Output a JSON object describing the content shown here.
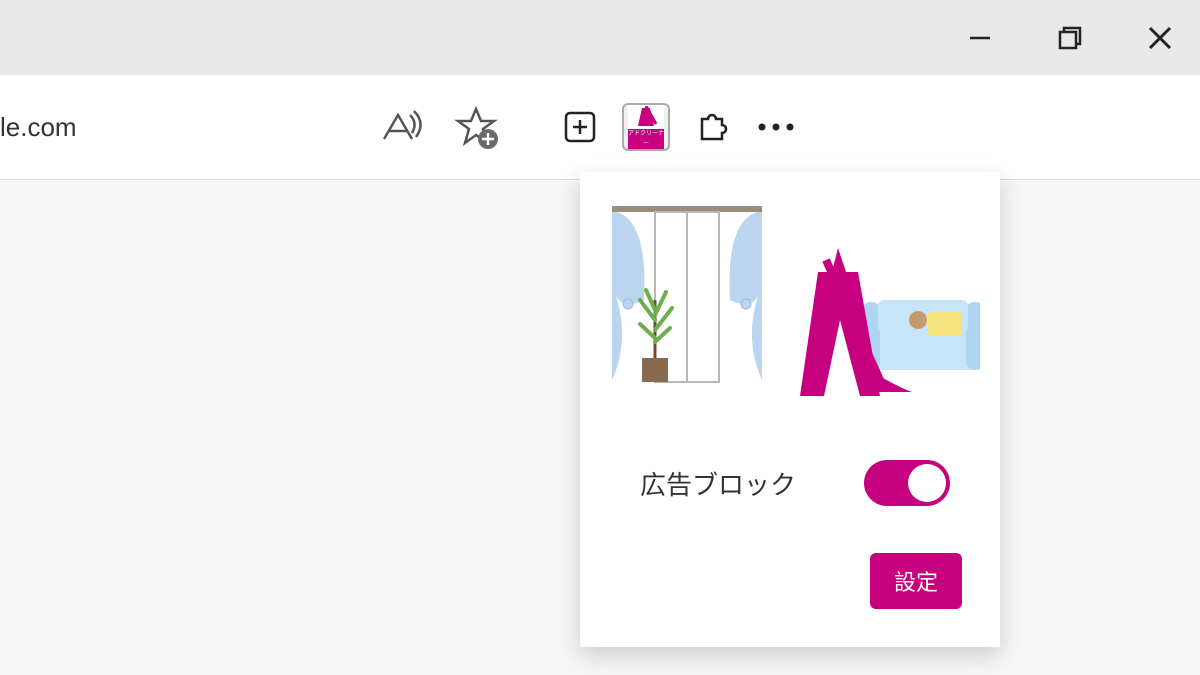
{
  "window": {
    "minimize_icon": "minimize",
    "maximize_icon": "maximize",
    "close_icon": "close"
  },
  "addressbar": {
    "url_fragment": "le.com",
    "read_aloud_icon": "read-aloud",
    "favorite_icon": "favorite-add"
  },
  "toolbar": {
    "collections_icon": "collections",
    "extension_name": "アドクリーナー",
    "extensions_icon": "extensions",
    "more_icon": "more"
  },
  "popup": {
    "toggle_label": "広告ブロック",
    "toggle_on": true,
    "settings_button": "設定"
  },
  "colors": {
    "accent": "#c6007e",
    "curtain": "#bcd5ef",
    "sofa": "#c7e4f8",
    "plant": "#6fae4f"
  }
}
